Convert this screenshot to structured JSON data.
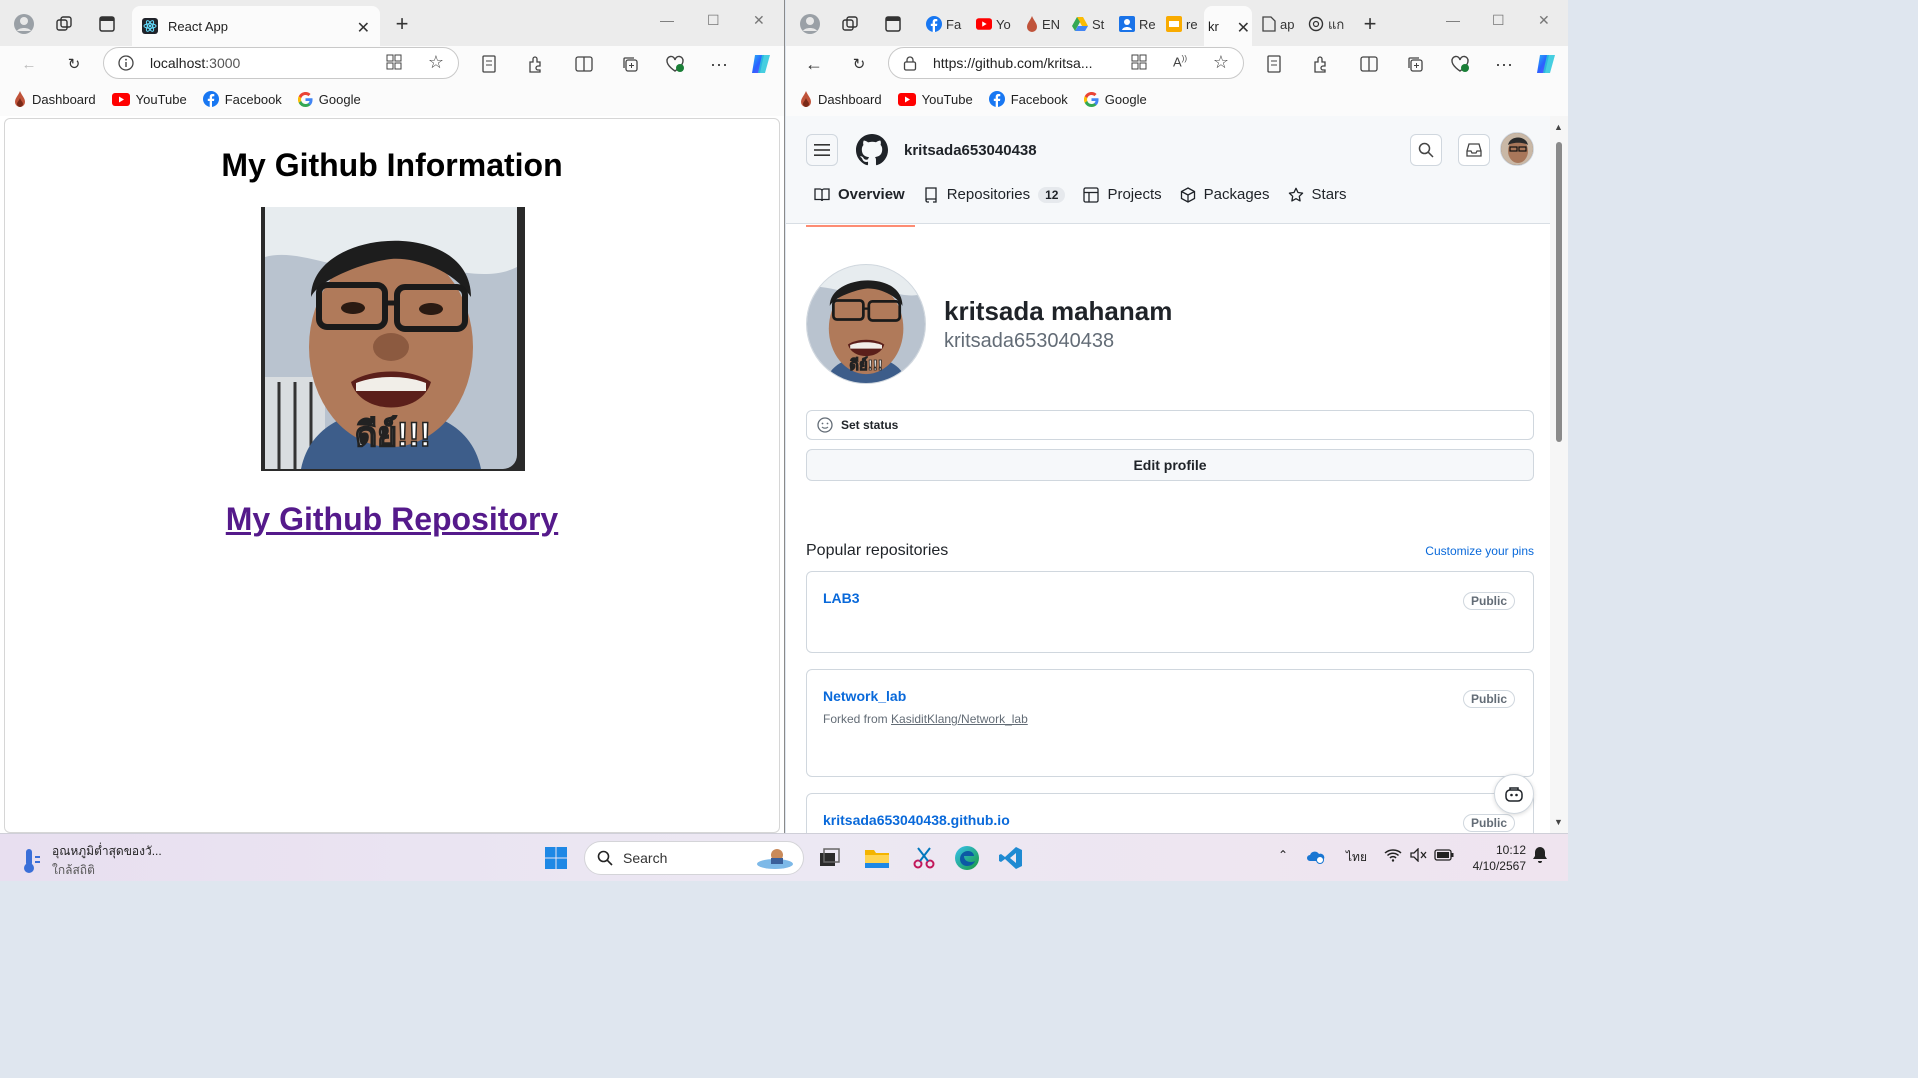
{
  "left_browser": {
    "tab_title": "React App",
    "address": "localhost:3000",
    "address_host": "localhost",
    "address_port": ":3000",
    "bookmarks": [
      "Dashboard",
      "YouTube",
      "Facebook",
      "Google"
    ],
    "page": {
      "heading": "My Github Information",
      "link_text": "My Github Repository",
      "photo_caption": "ดีย์!!!"
    }
  },
  "right_browser": {
    "tabs": [
      "Fa",
      "Yo",
      "EN",
      "St",
      "Re",
      "re",
      "kr",
      "ap",
      "แก"
    ],
    "address": "https://github.com/kritsa...",
    "bookmarks": [
      "Dashboard",
      "YouTube",
      "Facebook",
      "Google"
    ],
    "github": {
      "username_header": "kritsada653040438",
      "nav_tabs": [
        {
          "label": "Overview",
          "icon": "book-icon"
        },
        {
          "label": "Repositories",
          "icon": "repo-icon",
          "count": "12"
        },
        {
          "label": "Projects",
          "icon": "table-icon"
        },
        {
          "label": "Packages",
          "icon": "package-icon"
        },
        {
          "label": "Stars",
          "icon": "star-icon"
        }
      ],
      "full_name": "kritsada mahanam",
      "login": "kritsada653040438",
      "set_status": "Set status",
      "edit_profile": "Edit profile",
      "popular_title": "Popular repositories",
      "customize_pins": "Customize your pins",
      "repos": [
        {
          "name": "LAB3",
          "visibility": "Public"
        },
        {
          "name": "Network_lab",
          "visibility": "Public",
          "forked_prefix": "Forked from ",
          "forked_from": "KasiditKlang/Network_lab"
        },
        {
          "name": "kritsada653040438.github.io",
          "visibility": "Public"
        }
      ],
      "avatar_caption": "ดีย์!!!"
    }
  },
  "taskbar": {
    "weather_line1": "อุณหภูมิต่ำสุดของวั...",
    "weather_line2": "ใกล้สถิติ",
    "search_placeholder": "Search",
    "language": "ไทย",
    "time": "10:12",
    "date": "4/10/2567"
  },
  "colors": {
    "github_link": "#0969da",
    "visited_link": "#551a8b",
    "tab_underline": "#fd8c73"
  }
}
